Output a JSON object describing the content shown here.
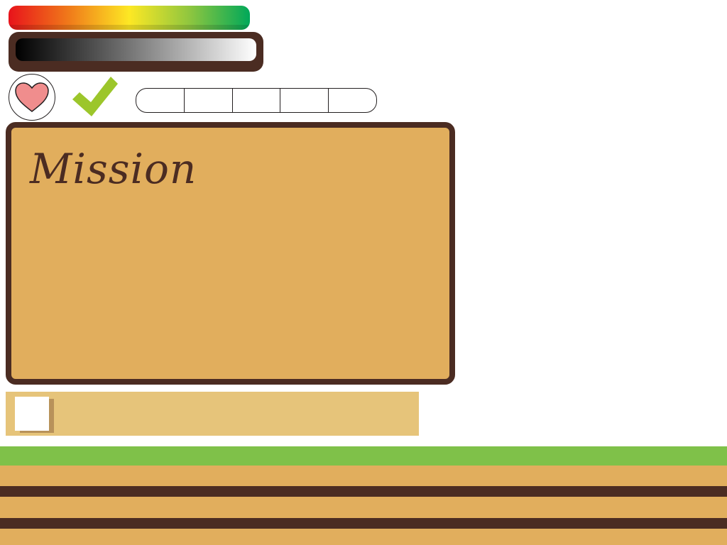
{
  "mission": {
    "title": "Mission"
  },
  "bars": {
    "health_gradient": [
      "#e8131b",
      "#f07a1a",
      "#fde824",
      "#8fc63f",
      "#00a859"
    ],
    "grayscale_gradient": [
      "#000000",
      "#ffffff"
    ]
  },
  "icons": {
    "heart": "heart-icon",
    "check": "checkmark-icon"
  },
  "segment_bar": {
    "segments": 5
  },
  "colors": {
    "frame_brown": "#4b2c22",
    "panel_tan": "#e1ae5d",
    "strip_tan": "#e6c47a",
    "grass_green": "#7fc149",
    "heart_pink": "#f08d8d",
    "check_green": "#9cc62b"
  }
}
